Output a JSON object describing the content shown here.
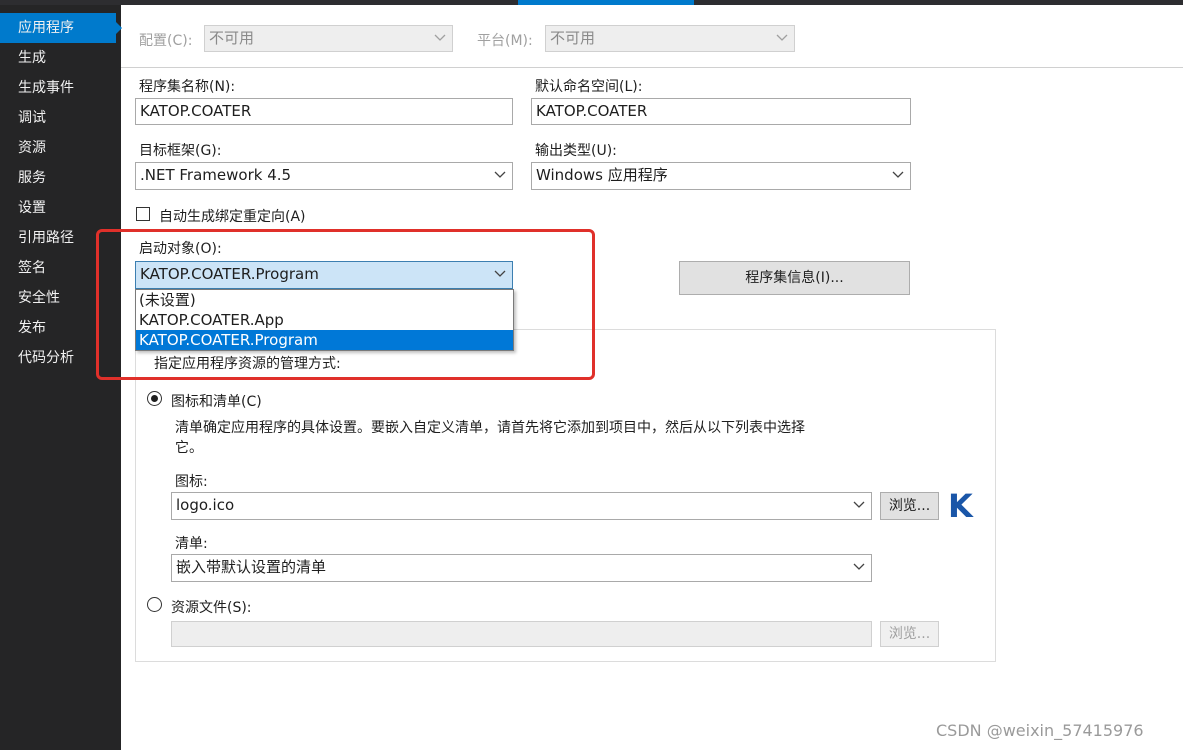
{
  "sidebar": {
    "items": [
      {
        "label": "应用程序",
        "active": true
      },
      {
        "label": "生成"
      },
      {
        "label": "生成事件"
      },
      {
        "label": "调试"
      },
      {
        "label": "资源"
      },
      {
        "label": "服务"
      },
      {
        "label": "设置"
      },
      {
        "label": "引用路径"
      },
      {
        "label": "签名"
      },
      {
        "label": "安全性"
      },
      {
        "label": "发布"
      },
      {
        "label": "代码分析"
      }
    ]
  },
  "toolbar": {
    "config_label": "配置(C):",
    "config_value": "不可用",
    "platform_label": "平台(M):",
    "platform_value": "不可用"
  },
  "form": {
    "assembly_name_label": "程序集名称(N):",
    "assembly_name_value": "KATOP.COATER",
    "default_namespace_label": "默认命名空间(L):",
    "default_namespace_value": "KATOP.COATER",
    "target_framework_label": "目标框架(G):",
    "target_framework_value": ".NET Framework 4.5",
    "output_type_label": "输出类型(U):",
    "output_type_value": "Windows 应用程序",
    "auto_binding_label": "自动生成绑定重定向(A)",
    "startup_object_label": "启动对象(O):",
    "startup_object_value": "KATOP.COATER.Program",
    "startup_options": [
      "(未设置)",
      "KATOP.COATER.App",
      "KATOP.COATER.Program"
    ],
    "assembly_info_button": "程序集信息(I)..."
  },
  "resources": {
    "heading": "指定应用程序资源的管理方式:",
    "icon_manifest_radio": "图标和清单(C)",
    "description": "清单确定应用程序的具体设置。要嵌入自定义清单，请首先将它添加到项目中，然后从以下列表中选择",
    "description_line2": "它。",
    "icon_label": "图标:",
    "icon_value": "logo.ico",
    "browse_label": "浏览...",
    "preview_letter": "K",
    "manifest_label": "清单:",
    "manifest_value": "嵌入带默认设置的清单",
    "resource_file_radio": "资源文件(S):",
    "resource_file_value": "",
    "browse2_label": "浏览..."
  },
  "watermark": "CSDN @weixin_57415976",
  "colors": {
    "accent": "#007acc",
    "sidebar_bg": "#252526",
    "highlight": "#e0302a",
    "selection": "#0078d7",
    "logo": "#1a56a8"
  }
}
